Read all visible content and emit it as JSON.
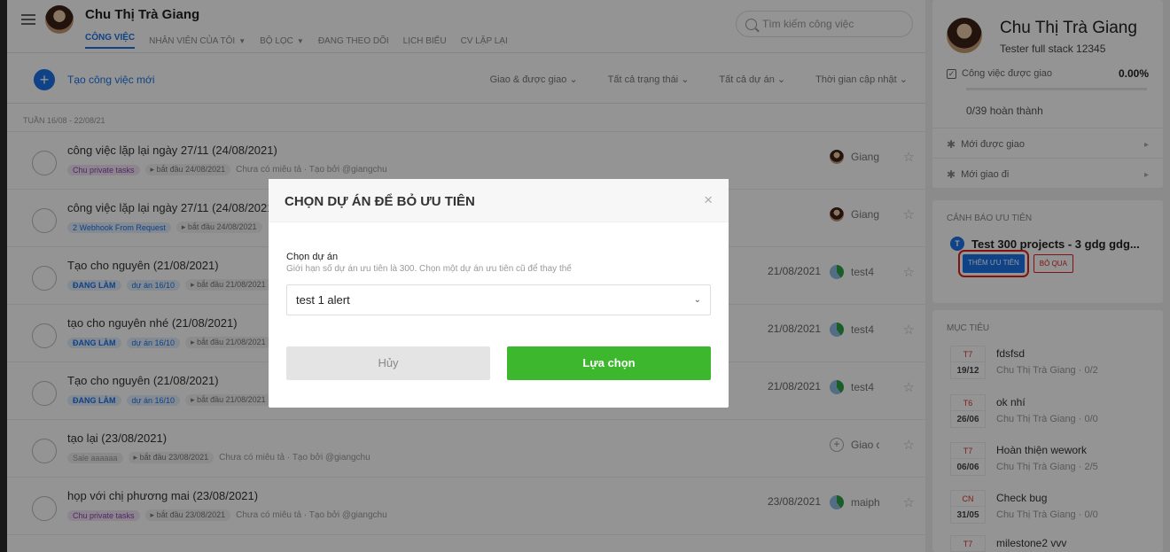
{
  "header": {
    "user_name": "Chu Thị Trà Giang",
    "search_placeholder": "Tìm kiếm công việc",
    "tabs": [
      {
        "label": "CÔNG VIỆC"
      },
      {
        "label": "NHÂN VIÊN CỦA TÔI"
      },
      {
        "label": "BỘ LỌC"
      },
      {
        "label": "ĐANG THEO DÕI"
      },
      {
        "label": "LỊCH BIỂU"
      },
      {
        "label": "CV LẶP LẠI"
      }
    ]
  },
  "toolbar": {
    "new_task": "Tạo công việc mới",
    "filters": [
      "Giao & được giao",
      "Tất cả trạng thái",
      "Tất cả dự án",
      "Thời gian cập nhật"
    ]
  },
  "week_label": "TUẦN 16/08 - 22/08/21",
  "tasks": [
    {
      "title": "công việc lặp lại ngày 27/11 (24/08/2021)",
      "chip": "Chu private tasks",
      "start": "bắt đầu 24/08/2021",
      "note": "Chưa có miêu tả · Tạo bởi @giangchu",
      "date": "",
      "assignee": "Giang"
    },
    {
      "title": "công việc lặp lại ngày 27/11 (24/08/2021)",
      "chip": "2 Webhook From Request",
      "start": "bắt đầu 24/08/2021",
      "note": "",
      "date": "",
      "assignee": "Giang"
    },
    {
      "title": "Tạo cho nguyên (21/08/2021)",
      "status": "ĐANG LÀM",
      "chip": "dự án 16/10",
      "start": "bắt đầu 21/08/2021",
      "note": "",
      "date": "21/08/2021",
      "assignee": "test4"
    },
    {
      "title": "tạo cho nguyên nhé (21/08/2021)",
      "status": "ĐANG LÀM",
      "chip": "dự án 16/10",
      "start": "bắt đầu 21/08/2021",
      "note": "",
      "date": "21/08/2021",
      "assignee": "test4"
    },
    {
      "title": "Tạo cho nguyên (21/08/2021)",
      "status": "ĐANG LÀM",
      "chip": "dự án 16/10",
      "start": "bắt đầu 21/08/2021",
      "note": "",
      "date": "21/08/2021",
      "assignee": "test4"
    },
    {
      "title": "tạo lại (23/08/2021)",
      "chip": "Sale aaaaaa",
      "start": "bắt đầu 23/08/2021",
      "note": "Chưa có miêu tả · Tạo bởi @giangchu",
      "date": "",
      "assignee": "Giao c..."
    },
    {
      "title": "họp với chị phương mai (23/08/2021)",
      "chip": "Chu private tasks",
      "start": "bắt đầu 23/08/2021",
      "note": "Chưa có miêu tả · Tạo bởi @giangchu",
      "date": "23/08/2021",
      "assignee": "maiph..."
    }
  ],
  "profile": {
    "name": "Chu Thị Trà Giang",
    "role": "Tester full stack 12345",
    "assigned_label": "Công việc được giao",
    "assigned_pct": "0.00%",
    "progress": 0,
    "done": "0/39 hoàn thành",
    "new_assigned": "Mới được giao",
    "new_delegated": "Mới giao đi"
  },
  "priority_warning": {
    "heading": "CẢNH BÁO ƯU TIÊN",
    "badge": "T",
    "project": "Test 300 projects - 3 gdg gdg...",
    "add_label": "THÊM ƯU TIÊN",
    "skip_label": "BỎ QUA"
  },
  "goals": {
    "heading": "MỤC TIÊU",
    "items": [
      {
        "day": "T7",
        "date": "19/12",
        "title": "fdsfsd",
        "sub": "Chu Thị Trà Giang · 0/2"
      },
      {
        "day": "T6",
        "date": "26/06",
        "title": "ok nhí",
        "sub": "Chu Thị Trà Giang · 0/0"
      },
      {
        "day": "T7",
        "date": "06/06",
        "title": "Hoàn thiện wework",
        "sub": "Chu Thị Trà Giang · 2/5"
      },
      {
        "day": "CN",
        "date": "31/05",
        "title": "Check bug",
        "sub": "Chu Thị Trà Giang · 0/0"
      },
      {
        "day": "T7",
        "date": "",
        "title": "milestone2 vvv",
        "sub": ""
      }
    ]
  },
  "modal": {
    "title": "CHỌN DỰ ÁN ĐỂ BỎ ƯU TIÊN",
    "field_label": "Chọn dự án",
    "help": "Giới hạn số dự án ưu tiên là 300. Chọn một dự án ưu tiên cũ để thay thế",
    "selected": "test 1 alert",
    "cancel": "Hủy",
    "confirm": "Lựa chọn"
  }
}
